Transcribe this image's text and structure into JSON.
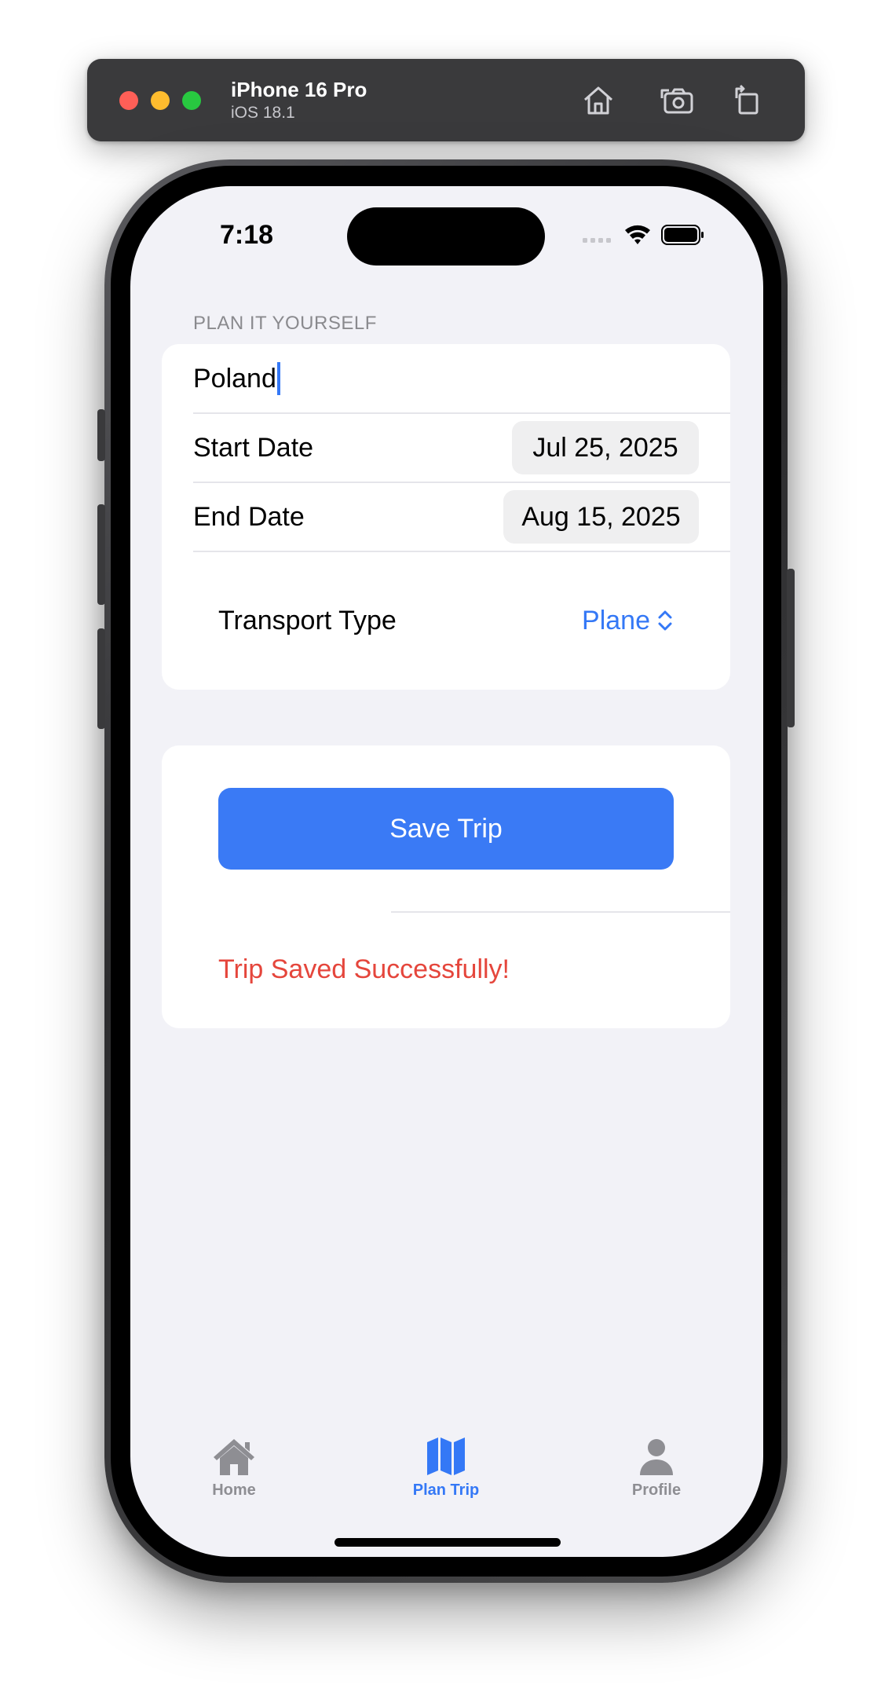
{
  "simulator": {
    "device_name": "iPhone 16 Pro",
    "os_version": "iOS 18.1",
    "buttons": [
      "home-icon",
      "screenshot-icon",
      "rotate-icon"
    ]
  },
  "status_bar": {
    "time": "7:18",
    "icons": [
      "cellular-icon",
      "wifi-icon",
      "battery-icon"
    ]
  },
  "form": {
    "section_header": "PLAN IT YOURSELF",
    "destination_value": "Poland",
    "start_date_label": "Start Date",
    "start_date_value": "Jul 25, 2025",
    "end_date_label": "End Date",
    "end_date_value": "Aug 15, 2025",
    "transport_label": "Transport Type",
    "transport_value": "Plane"
  },
  "actions": {
    "save_label": "Save Trip",
    "success_message": "Trip Saved Successfully!"
  },
  "tab_bar": {
    "items": [
      {
        "label": "Home",
        "icon": "house-icon",
        "active": false
      },
      {
        "label": "Plan Trip",
        "icon": "map-icon",
        "active": true
      },
      {
        "label": "Profile",
        "icon": "person-icon",
        "active": false
      }
    ]
  },
  "colors": {
    "accent": "#3478f6",
    "save_button": "#3a7af5",
    "success_text": "#e5463c",
    "background": "#f2f2f7",
    "inactive_tab": "#8e8e93"
  }
}
